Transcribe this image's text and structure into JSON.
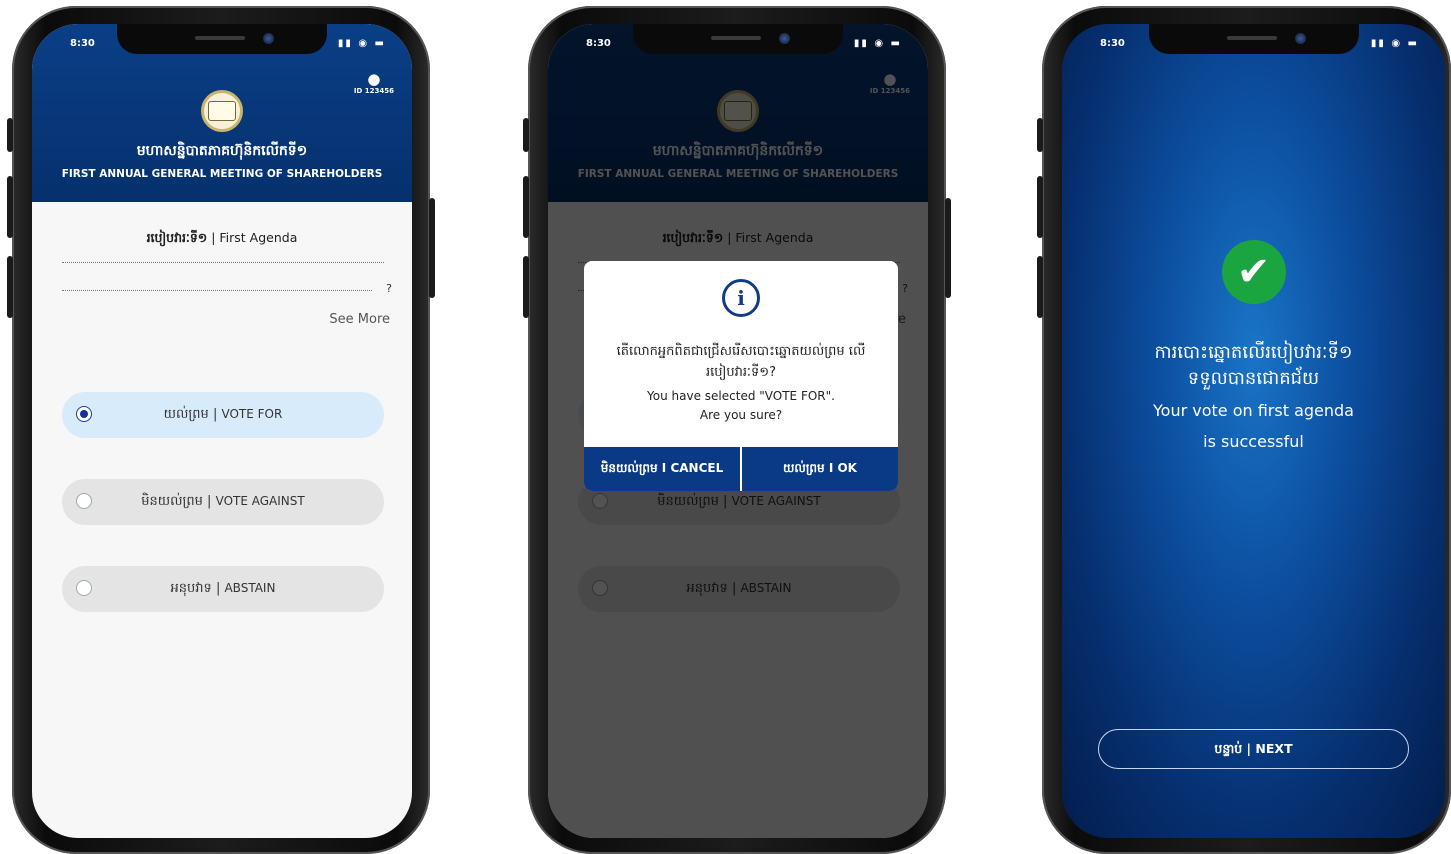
{
  "status": {
    "time": "8:30",
    "icons": "▮▮ ◉ ▬"
  },
  "header": {
    "user_id": "ID 123456",
    "title_kh": "មហាសន្និបាតភាគហ៊ុនិកលើកទី១",
    "title_en": "FIRST ANNUAL GENERAL MEETING OF SHAREHOLDERS"
  },
  "agenda": {
    "title_kh": "របៀបវារៈទី១",
    "title_sep": " | ",
    "title_en": "First Agenda",
    "question_mark": "?",
    "see_more": "See More"
  },
  "options": [
    {
      "kh": "យល់ព្រម",
      "sep": " | ",
      "en": "VOTE FOR",
      "selected": true
    },
    {
      "kh": "មិនយល់ព្រម",
      "sep": " | ",
      "en": "VOTE AGAINST",
      "selected": false
    },
    {
      "kh": "អនុបវាទ",
      "sep": " | ",
      "en": "ABSTAIN",
      "selected": false
    }
  ],
  "dialog": {
    "icon": "i",
    "kh_line1": "តើលោកអ្នកពិតជាជ្រើសរើសបោះឆ្នោតយល់ព្រម លើ",
    "kh_line2": "របៀបវារៈទី១?",
    "en_line1": "You have selected \"VOTE FOR\".",
    "en_line2": "Are you sure?",
    "cancel_label": "មិនយល់ព្រម I CANCEL",
    "ok_label": "យល់ព្រម I OK"
  },
  "success": {
    "check": "✔",
    "kh_line1": "ការបោះឆ្នោតលើរបៀបវារៈទី១",
    "kh_line2": "ទទួលបានជោគជ័យ",
    "en_line1": "Your vote on first agenda",
    "en_line2": "is successful",
    "next_label": "បន្ទាប់ | NEXT"
  },
  "colors": {
    "header_blue": "#0a3f86",
    "accent_green": "#1aa540",
    "selected_bg": "#d8ebfb"
  }
}
